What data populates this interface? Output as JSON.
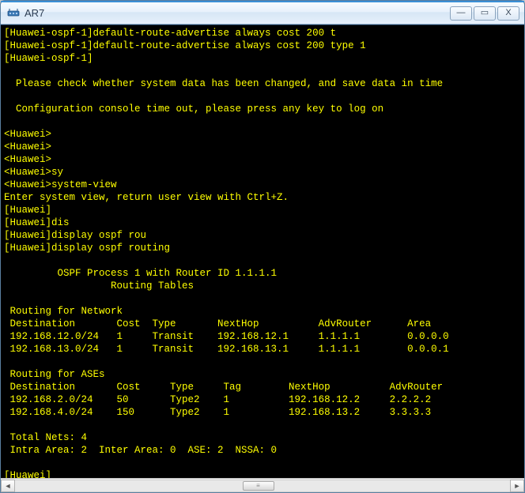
{
  "window": {
    "title": "AR7",
    "icon": "router-icon"
  },
  "controls": {
    "minimize": "—",
    "maximize": "▭",
    "close": "X"
  },
  "terminal": {
    "lines": [
      "[Huawei-ospf-1]default-route-advertise always cost 200 t",
      "[Huawei-ospf-1]default-route-advertise always cost 200 type 1",
      "[Huawei-ospf-1]",
      "",
      "  Please check whether system data has been changed, and save data in time",
      "",
      "  Configuration console time out, please press any key to log on",
      "",
      "<Huawei>",
      "<Huawei>",
      "<Huawei>",
      "<Huawei>sy",
      "<Huawei>system-view",
      "Enter system view, return user view with Ctrl+Z.",
      "[Huawei]",
      "[Huawei]dis",
      "[Huawei]display ospf rou",
      "[Huawei]display ospf routing",
      "",
      "         OSPF Process 1 with Router ID 1.1.1.1",
      "                  Routing Tables",
      ""
    ],
    "routing_network": {
      "heading": " Routing for Network",
      "columns": [
        " Destination",
        "Cost",
        "Type",
        "NextHop",
        "AdvRouter",
        "Area"
      ],
      "rows": [
        [
          " 192.168.12.0/24",
          "1",
          "Transit",
          "192.168.12.1",
          "1.1.1.1",
          "0.0.0.0"
        ],
        [
          " 192.168.13.0/24",
          "1",
          "Transit",
          "192.168.13.1",
          "1.1.1.1",
          "0.0.0.1"
        ]
      ]
    },
    "routing_ases": {
      "heading": " Routing for ASEs",
      "columns": [
        " Destination",
        "Cost",
        "Type",
        "Tag",
        "NextHop",
        "AdvRouter"
      ],
      "rows": [
        [
          " 192.168.2.0/24",
          "50",
          "Type2",
          "1",
          "192.168.12.2",
          "2.2.2.2"
        ],
        [
          " 192.168.4.0/24",
          "150",
          "Type2",
          "1",
          "192.168.13.2",
          "3.3.3.3"
        ]
      ]
    },
    "totals": {
      "total_nets": " Total Nets: 4",
      "breakdown": " Intra Area: 2  Inter Area: 0  ASE: 2  NSSA: 0"
    },
    "prompt": "[Huawei]"
  },
  "scrollbar": {
    "left": "◄",
    "right": "►",
    "grip": "≡"
  },
  "colors": {
    "terminal_bg": "#000000",
    "terminal_fg": "#ffff00",
    "titlebar_text": "#2b3c52"
  }
}
